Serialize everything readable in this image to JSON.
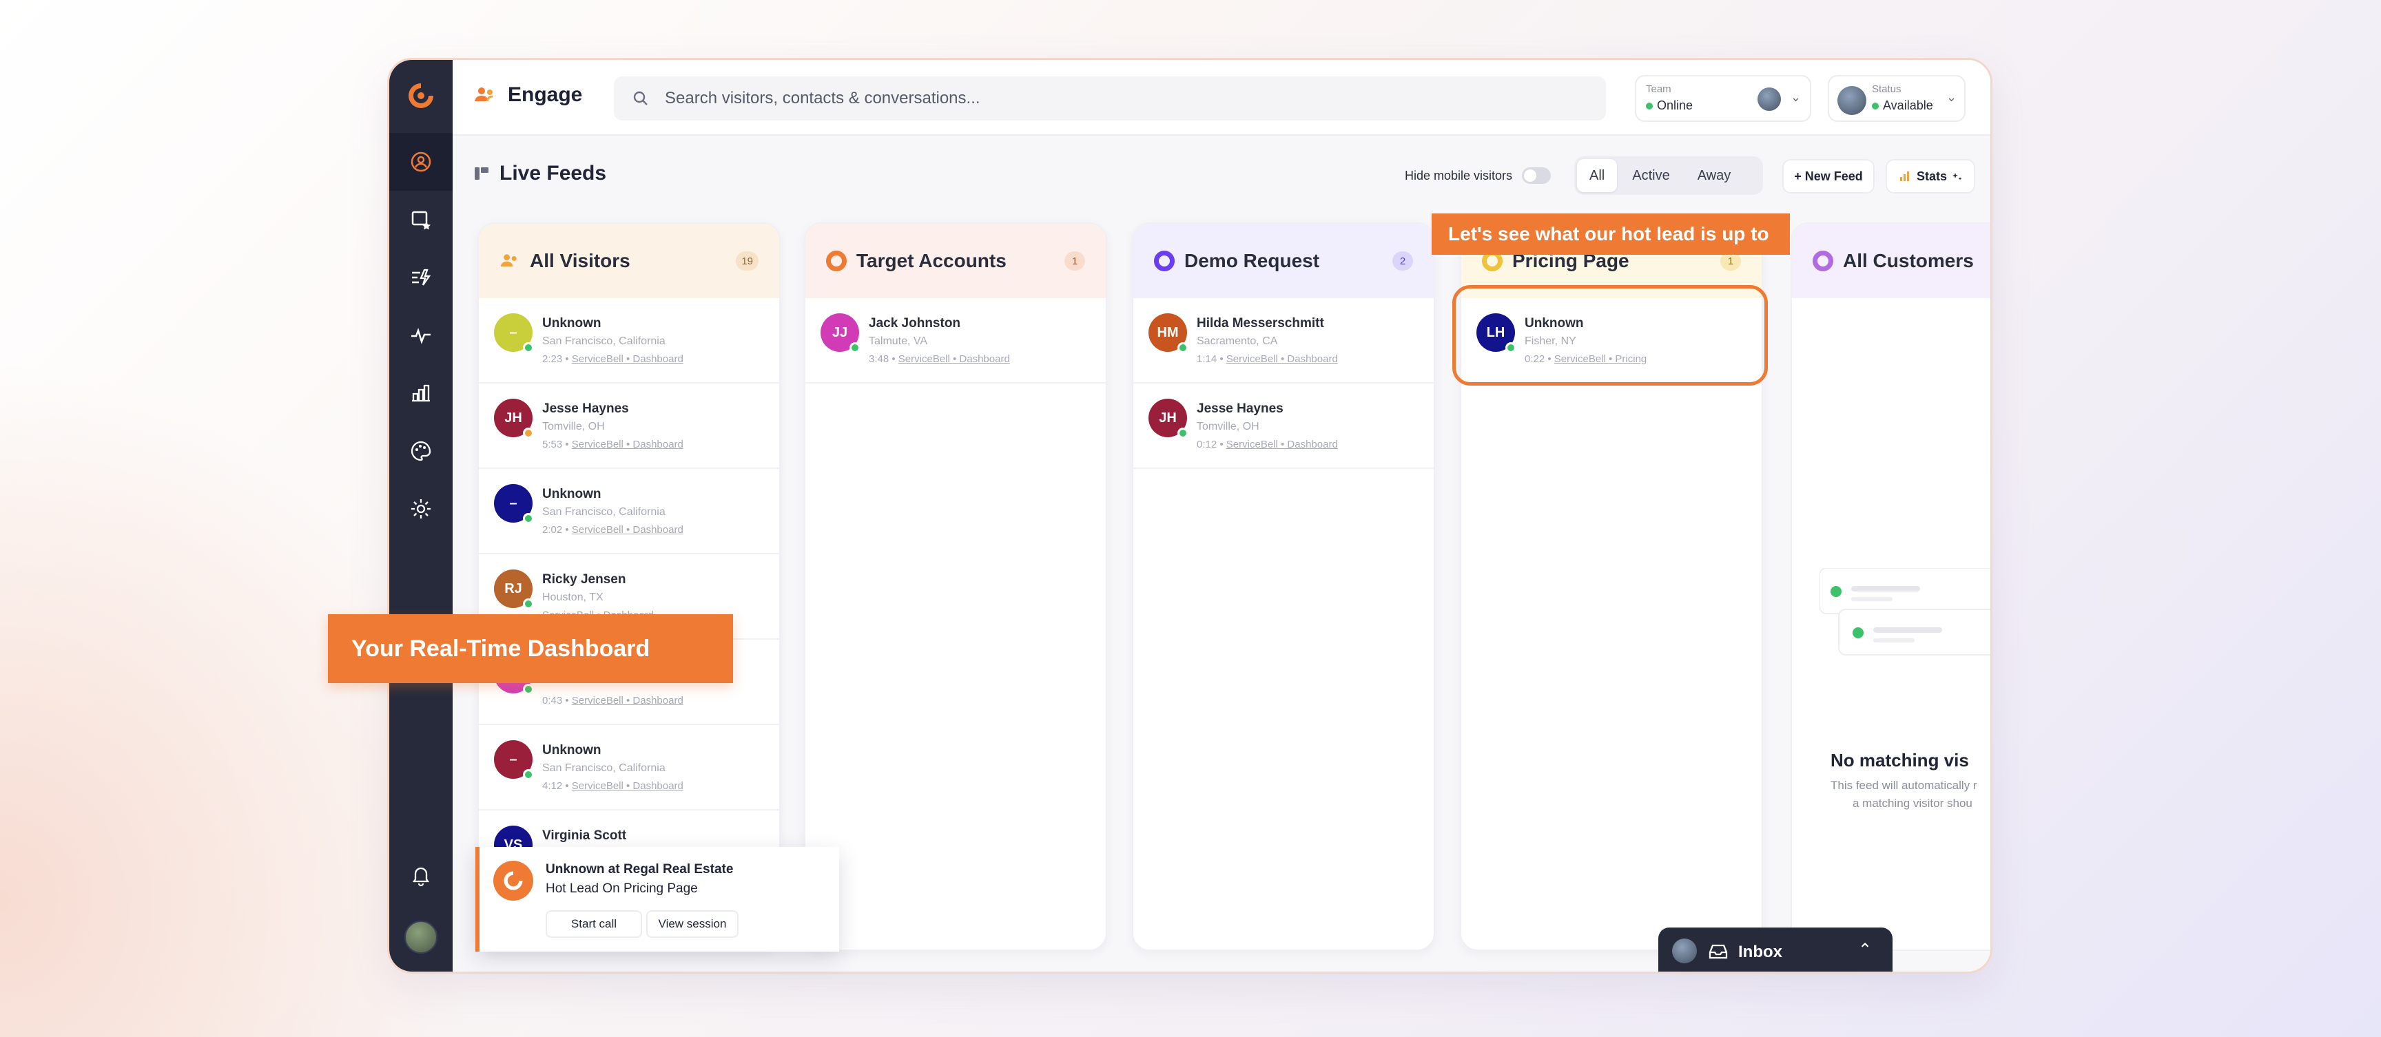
{
  "app": {
    "title": "Engage"
  },
  "search": {
    "placeholder": "Search visitors, contacts & conversations..."
  },
  "team": {
    "label": "Team",
    "value": "Online"
  },
  "status": {
    "label": "Status",
    "value": "Available"
  },
  "feeds": {
    "title": "Live Feeds",
    "hide_mobile_label": "Hide mobile visitors",
    "filters": [
      "All",
      "Active",
      "Away"
    ],
    "active_filter": "All",
    "new_feed_label": "+ New Feed",
    "stats_label": "Stats"
  },
  "columns": [
    {
      "title": "All Visitors",
      "count": "19",
      "accent": "#f0a33c",
      "cards": [
        {
          "initials": "–",
          "color": "#c9cf3a",
          "status": "on",
          "name": "Unknown",
          "location": "San Francisco, California",
          "time": "2:23",
          "link": "ServiceBell • Dashboard"
        },
        {
          "initials": "JH",
          "color": "#9a1f3b",
          "status": "away",
          "name": "Jesse Haynes",
          "location": "Tomville, OH",
          "time": "5:53",
          "link": "ServiceBell • Dashboard"
        },
        {
          "initials": "–",
          "color": "#14138e",
          "status": "on",
          "name": "Unknown",
          "location": "San Francisco, California",
          "time": "2:02",
          "link": "ServiceBell • Dashboard"
        },
        {
          "initials": "RJ",
          "color": "#b8652d",
          "status": "on",
          "name": "Ricky Jensen",
          "location": "Houston, TX",
          "time": "",
          "link": "ServiceBell • Dashboard"
        },
        {
          "initials": "",
          "color": "#d13cb6",
          "status": "on",
          "name": "",
          "location": "",
          "time": "0:43",
          "link": "ServiceBell • Dashboard"
        },
        {
          "initials": "–",
          "color": "#9a1f3b",
          "status": "on",
          "name": "Unknown",
          "location": "San Francisco, California",
          "time": "4:12",
          "link": "ServiceBell • Dashboard"
        },
        {
          "initials": "VS",
          "color": "#14138e",
          "status": "on",
          "name": "Virginia Scott",
          "location": "",
          "time": "",
          "link": ""
        }
      ]
    },
    {
      "title": "Target Accounts",
      "count": "1",
      "accent": "#ee7a33",
      "cards": [
        {
          "initials": "JJ",
          "color": "#d13cb6",
          "status": "on",
          "name": "Jack Johnston",
          "location": "Talmute, VA",
          "time": "3:48",
          "link": "ServiceBell • Dashboard"
        }
      ]
    },
    {
      "title": "Demo Request",
      "count": "2",
      "accent": "#6b3df0",
      "cards": [
        {
          "initials": "HM",
          "color": "#c8551f",
          "status": "on",
          "name": "Hilda Messerschmitt",
          "location": "Sacramento, CA",
          "time": "1:14",
          "link": "ServiceBell • Dashboard"
        },
        {
          "initials": "JH",
          "color": "#9a1f3b",
          "status": "on",
          "name": "Jesse Haynes",
          "location": "Tomville, OH",
          "time": "0:12",
          "link": "ServiceBell • Dashboard"
        }
      ]
    },
    {
      "title": "Pricing Page",
      "count": "1",
      "accent": "#f0c23c",
      "cards": [
        {
          "initials": "LH",
          "color": "#14138e",
          "status": "on",
          "name": "Unknown",
          "location": "Fisher, NY",
          "time": "0:22",
          "link": "ServiceBell • Pricing"
        }
      ]
    }
  ],
  "all_customers": {
    "title": "All Customers",
    "empty_title": "No matching vis",
    "empty_line1": "This feed will automatically r",
    "empty_line2": "a matching visitor shou"
  },
  "callouts": {
    "dashboard": "Your Real-Time Dashboard",
    "hot_lead": "Let's see what our hot lead is up to"
  },
  "popup": {
    "title": "Unknown at Regal Real Estate",
    "subtitle": "Hot Lead On Pricing Page",
    "start_call": "Start call",
    "view_session": "View session"
  },
  "inbox": {
    "label": "Inbox"
  },
  "colors": {
    "accent": "#ee7a33",
    "sidebar": "#262a3a",
    "online": "#3cc26a"
  }
}
